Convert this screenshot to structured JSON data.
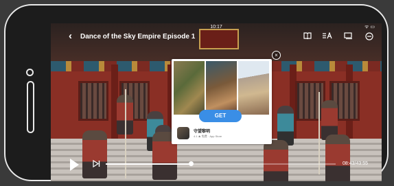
{
  "status": {
    "time": "10:17",
    "icons": "ᯤ ▭"
  },
  "video": {
    "title": "Dance of the Sky Empire Episode 1",
    "elapsed": "08:43",
    "separator": "/",
    "total": "43:55",
    "progress": 0.37
  },
  "toolbar": {
    "back_icon": "‹",
    "icons": [
      "book-icon",
      "subtitle-icon",
      "pip-icon",
      "settings-icon"
    ]
  },
  "ad": {
    "close_label": "×",
    "get_label": "GET",
    "app_name": "守望黎明",
    "app_meta": "4.1 ★ 免费 · App Store"
  },
  "controls": {
    "next_glyph": "⊳|"
  }
}
